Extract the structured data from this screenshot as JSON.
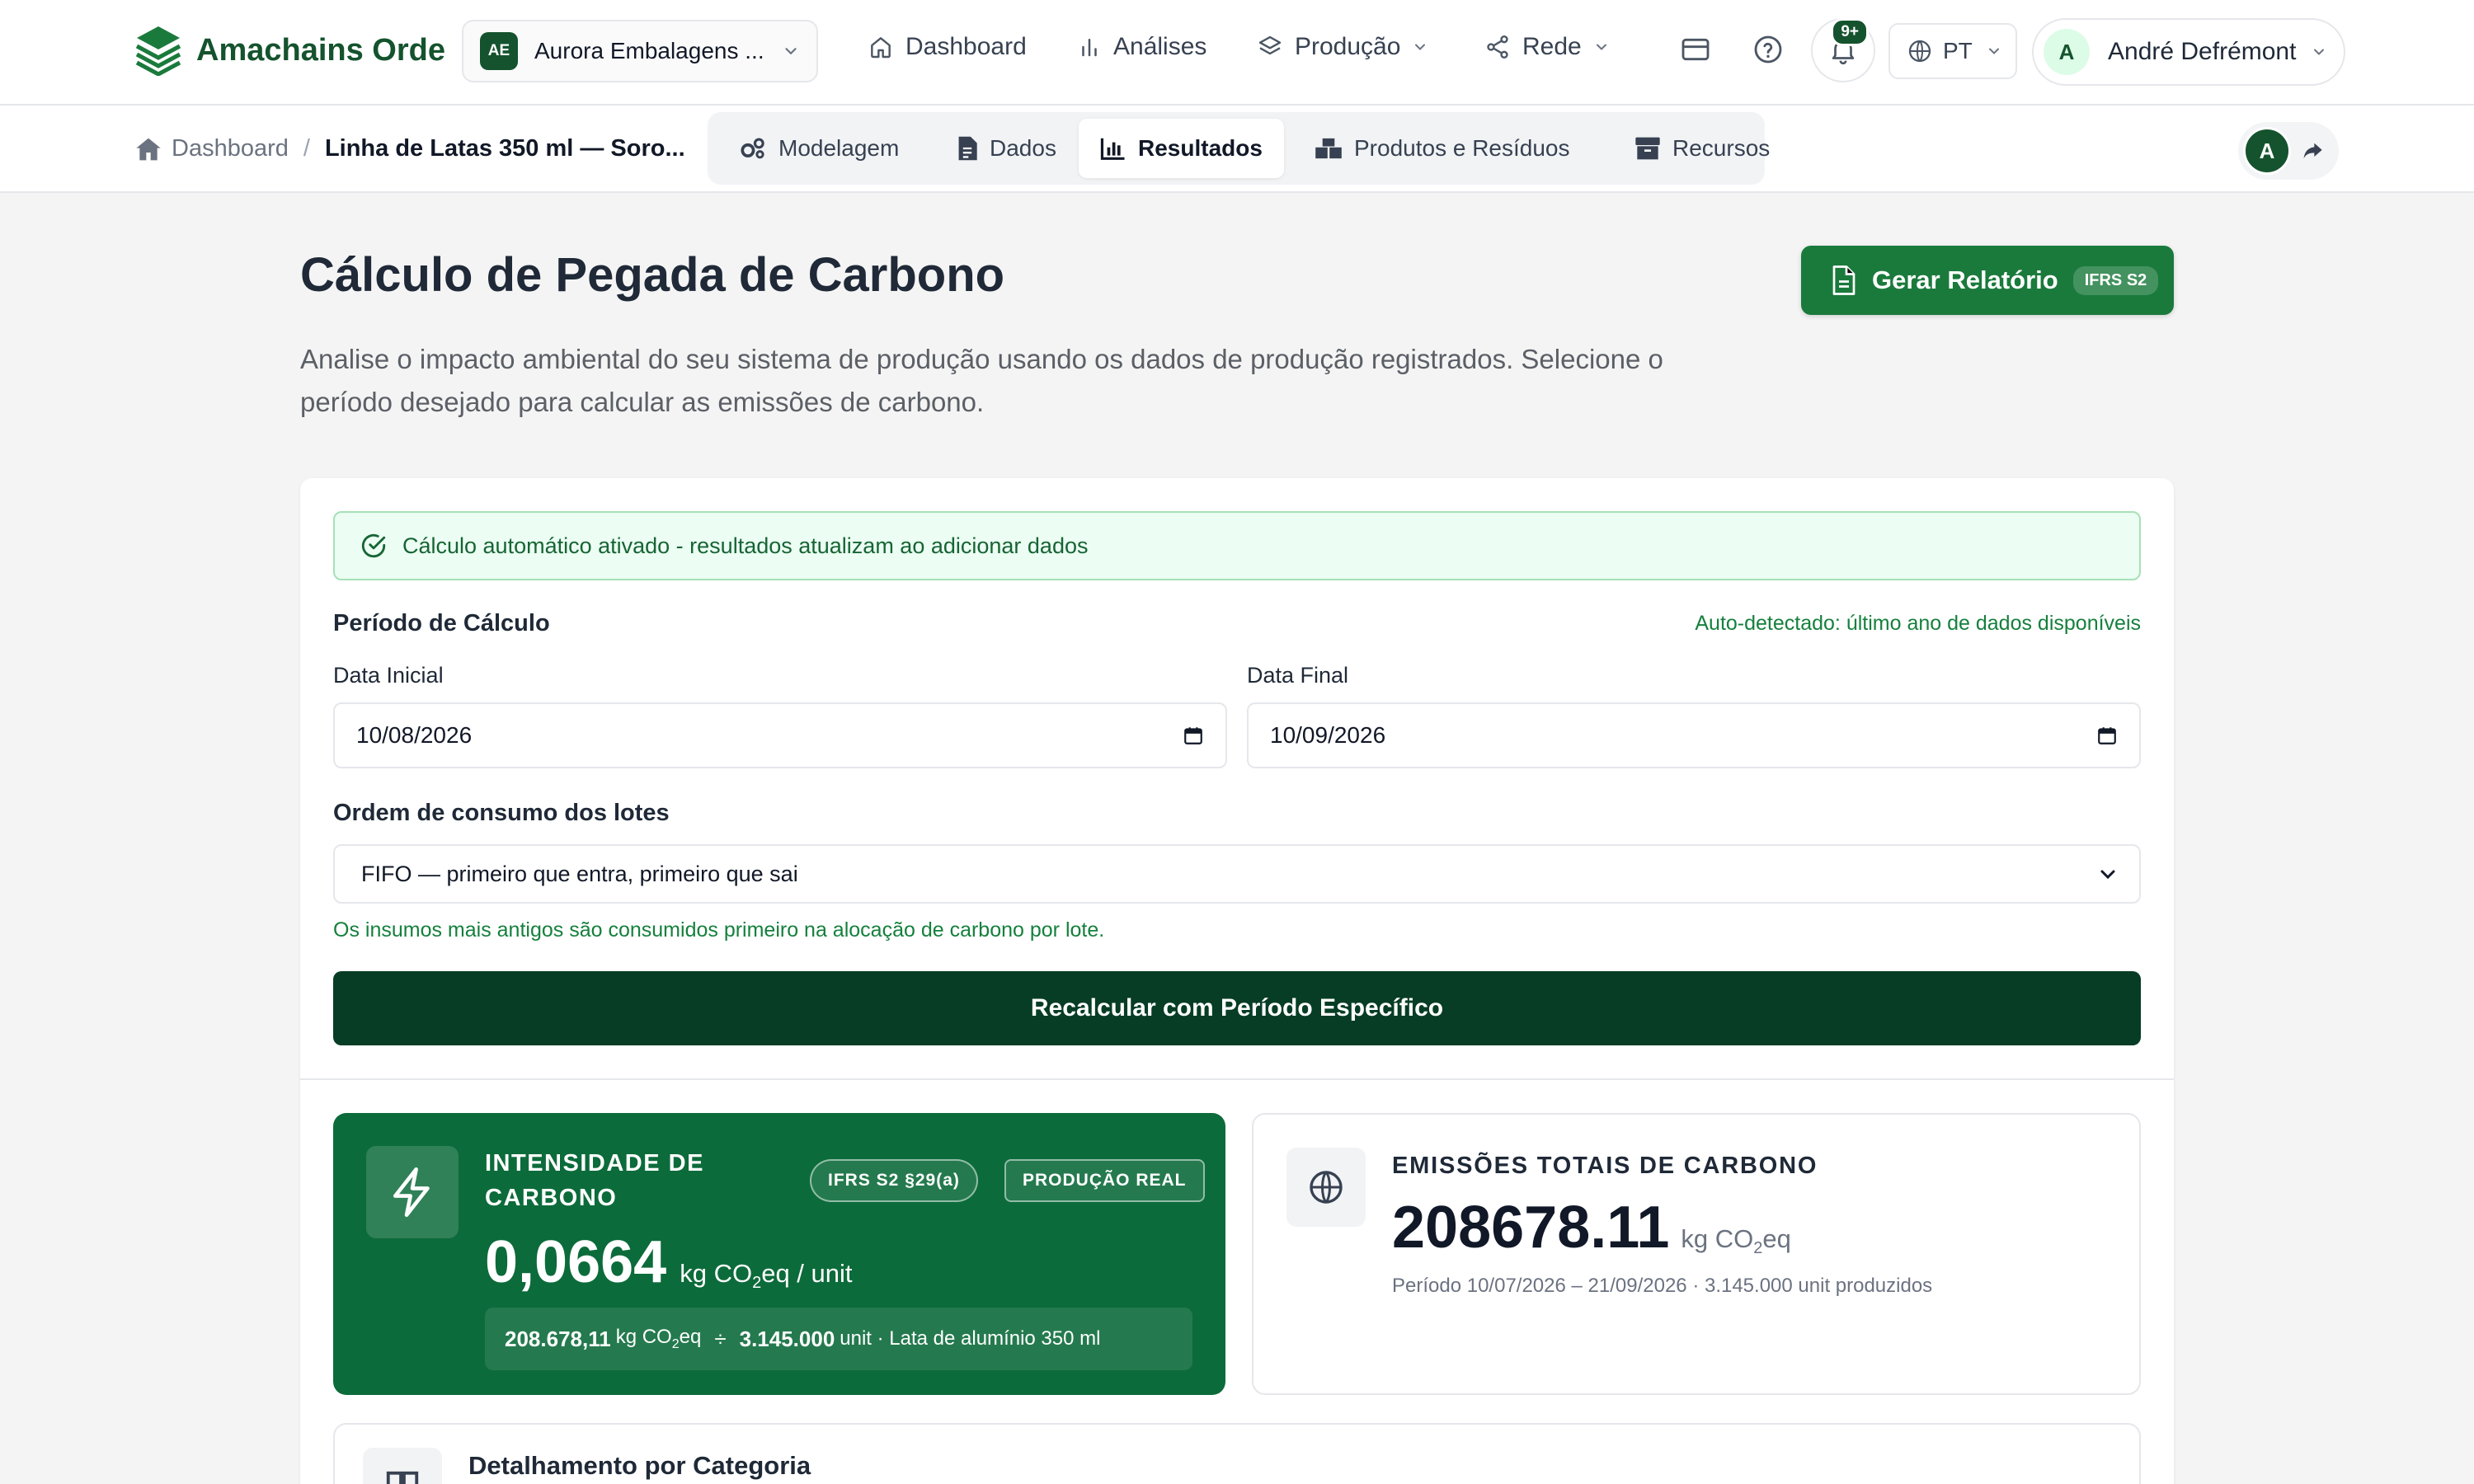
{
  "app": {
    "brand": "Amachains Orde",
    "org_badge": "AE",
    "org_name": "Aurora Embalagens ...",
    "nav": [
      "Dashboard",
      "Análises",
      "Produção",
      "Rede"
    ],
    "notifications": "9+",
    "language": "PT",
    "user_initial": "A",
    "user_name": "André Defrémont",
    "colors": {
      "brand_green": "#14532d",
      "accent_green": "#0c6b3a",
      "button_dark": "#063d24"
    }
  },
  "breadcrumb": {
    "home": "Dashboard",
    "sep": "/",
    "current": "Linha de Latas 350 ml — Soro..."
  },
  "tabs": [
    {
      "label": "Modelagem",
      "icon": "cogs-icon"
    },
    {
      "label": "Dados",
      "icon": "document-icon"
    },
    {
      "label": "Resultados",
      "icon": "bar-chart-icon",
      "active": true
    },
    {
      "label": "Produtos e Resíduos",
      "icon": "boxes-icon"
    },
    {
      "label": "Recursos",
      "icon": "archive-icon"
    }
  ],
  "collaborator_initial": "A",
  "page": {
    "title": "Cálculo de Pegada de Carbono",
    "description": "Analise o impacto ambiental do seu sistema de produção usando os dados de produção registrados. Selecione o período desejado para calcular as emissões de carbono.",
    "report_button": "Gerar Relatório",
    "report_tag": "IFRS S2"
  },
  "form": {
    "auto_banner": "Cálculo automático ativado - resultados atualizam ao adicionar dados",
    "period_label": "Período de Cálculo",
    "auto_detected": "Auto-detectado: último ano de dados disponíveis",
    "start_label": "Data Inicial",
    "start_value": "10/08/2026",
    "end_label": "Data Final",
    "end_value": "10/09/2026",
    "order_label": "Ordem de consumo dos lotes",
    "order_value": "FIFO — primeiro que entra, primeiro que sai",
    "order_hint": "Os insumos mais antigos são consumidos primeiro na alocação de carbono por lote.",
    "recalc_button": "Recalcular com Período Específico"
  },
  "intensity": {
    "title": "INTENSIDADE DE CARBONO",
    "pill_1": "IFRS S2 §29(a)",
    "pill_2": "PRODUÇÃO REAL",
    "value": "0,0664",
    "unit_prefix": "kg CO",
    "unit_sub": "2",
    "unit_suffix": "eq / unit",
    "calc_emissions": "208.678,11",
    "calc_emissions_unit_prefix": "kg CO",
    "calc_emissions_unit_sub": "2",
    "calc_emissions_unit_suffix": "eq",
    "calc_op": "÷",
    "calc_units": "3.145.000",
    "calc_units_tail": "unit · Lata de alumínio 350 ml"
  },
  "total": {
    "title": "EMISSÕES TOTAIS DE CARBONO",
    "value": "208678.11",
    "unit_prefix": "kg CO",
    "unit_sub": "2",
    "unit_suffix": "eq",
    "meta": "Período 10/07/2026 – 21/09/2026 · 3.145.000 unit produzidos"
  },
  "breakdown": {
    "title": "Detalhamento por Categoria"
  }
}
